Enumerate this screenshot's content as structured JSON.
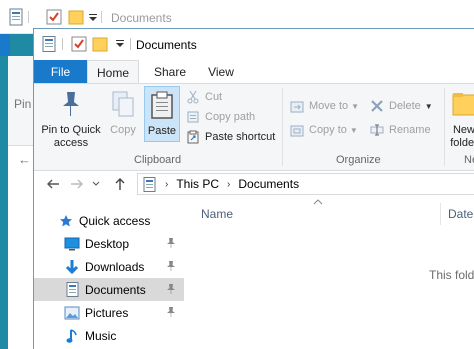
{
  "background_window": {
    "title": "Documents",
    "partial_ribbon_text": "Pin",
    "back_arrow": "←"
  },
  "window": {
    "title": "Documents"
  },
  "tabs": {
    "file": "File",
    "home": "Home",
    "share": "Share",
    "view": "View"
  },
  "ribbon": {
    "pin_quick_access_line1": "Pin to Quick",
    "pin_quick_access_line2": "access",
    "copy": "Copy",
    "paste": "Paste",
    "cut": "Cut",
    "copy_path": "Copy path",
    "paste_shortcut": "Paste shortcut",
    "clipboard_group": "Clipboard",
    "move_to": "Move to",
    "copy_to": "Copy to",
    "delete": "Delete",
    "rename": "Rename",
    "organize_group": "Organize",
    "new_folder_line1": "New",
    "new_folder_line2": "folder",
    "new_group_partial": "Ne"
  },
  "address": {
    "this_pc": "This PC",
    "documents": "Documents"
  },
  "nav_pane": {
    "items": [
      {
        "label": "Quick access"
      },
      {
        "label": "Desktop"
      },
      {
        "label": "Downloads"
      },
      {
        "label": "Documents"
      },
      {
        "label": "Pictures"
      },
      {
        "label": "Music"
      }
    ]
  },
  "content": {
    "col_name": "Name",
    "col_date": "Date",
    "empty_message": "This folde"
  },
  "colors": {
    "accent": "#1979ca",
    "desktop_bg": "#1e8aa3",
    "selected_bg": "#d9d9d9"
  }
}
